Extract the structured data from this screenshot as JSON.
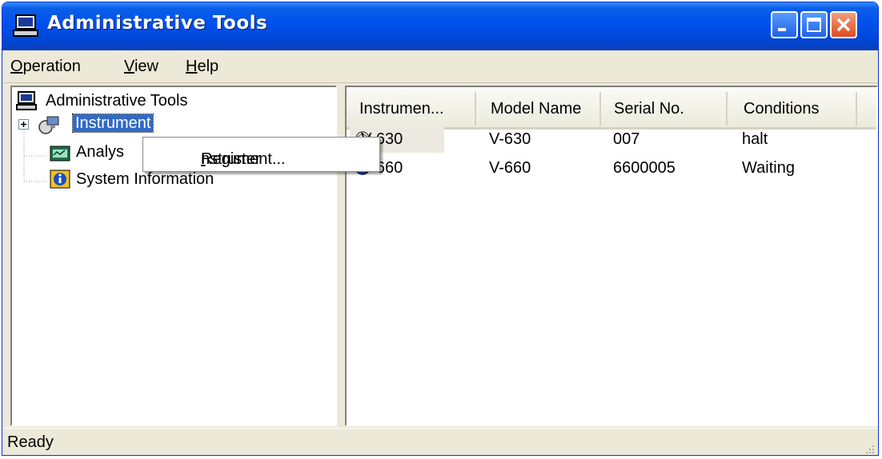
{
  "window": {
    "title": "Administrative Tools",
    "accent": "#0050ee"
  },
  "menubar": {
    "operation_prefix": "",
    "operation_ul": "O",
    "operation_rest": "peration",
    "view_ul": "V",
    "view_rest": "iew",
    "help_ul": "H",
    "help_rest": "elp"
  },
  "tree": {
    "root_label": "Administrative Tools",
    "instrument_label": "Instrument",
    "analysis_label": "Analys",
    "sysinfo_label": "System Information"
  },
  "context_menu": {
    "item_prefix": "Register ",
    "item_ul": "I",
    "item_rest": "nstrument..."
  },
  "list": {
    "columns": [
      "Instrumen...",
      "Model Name",
      "Serial No.",
      "Conditions"
    ],
    "rows": [
      {
        "name": "V-630",
        "model": "V-630",
        "serial": "007",
        "condition": "halt",
        "icon": "instrument-idle-icon"
      },
      {
        "name": "V-660",
        "model": "V-660",
        "serial": "6600005",
        "condition": "Waiting",
        "icon": "instrument-active-icon"
      }
    ]
  },
  "status": {
    "text": "Ready"
  }
}
